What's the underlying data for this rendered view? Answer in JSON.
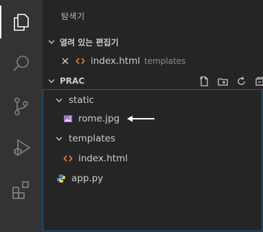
{
  "sidebar": {
    "title": "탐색기"
  },
  "open_editors": {
    "header": "열려 있는 편집기",
    "items": [
      {
        "name": "index.html",
        "folder": "templates",
        "icon": "html-icon"
      }
    ]
  },
  "project": {
    "header": "PRAC",
    "tree": {
      "static_folder": "static",
      "rome_file": "rome.jpg",
      "templates_folder": "templates",
      "index_file": "index.html",
      "app_file": "app.py"
    }
  },
  "colors": {
    "html_icon": "#e37933",
    "python_icon": "#3b8ccf",
    "image_icon": "#a074c4",
    "focus_border": "#0e639c"
  }
}
